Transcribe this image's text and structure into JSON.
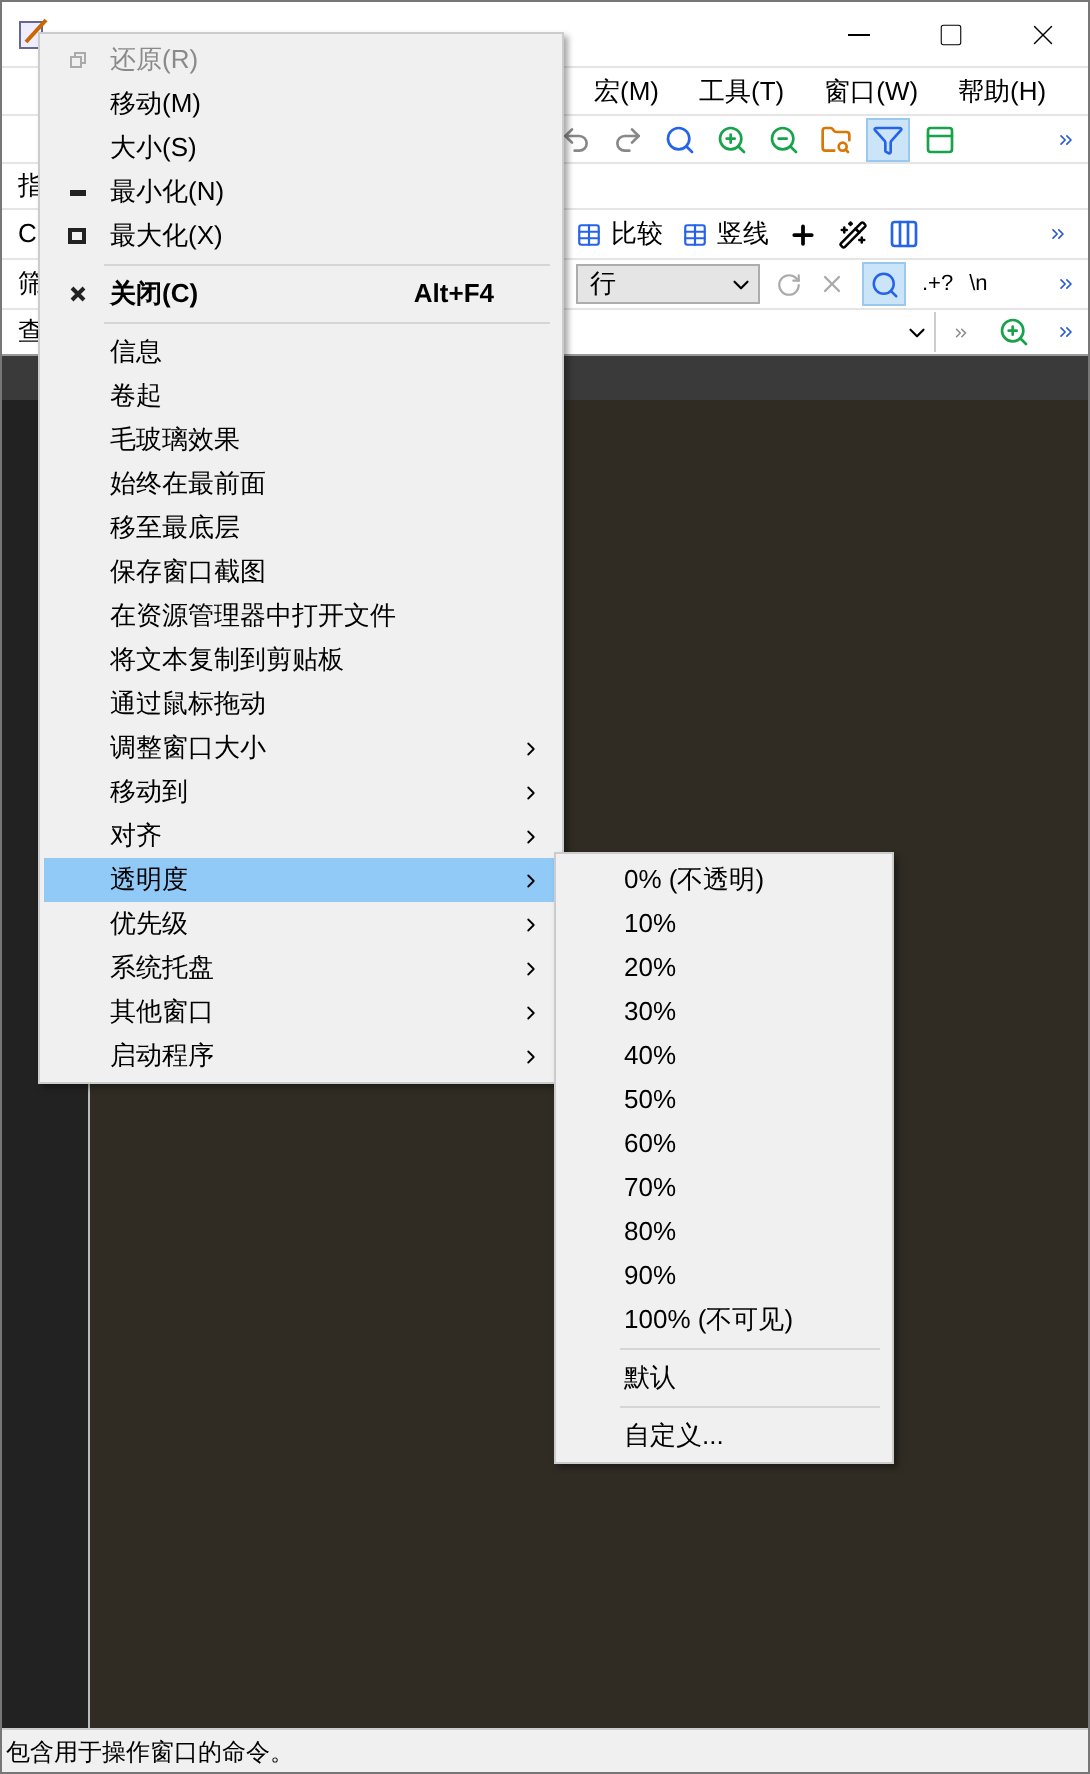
{
  "menubar": [
    {
      "label": "宏(M)"
    },
    {
      "label": "工具(T)"
    },
    {
      "label": "窗口(W)"
    },
    {
      "label": "帮助(H)"
    }
  ],
  "toolbar": [
    {
      "kind": "undo",
      "pressed": false
    },
    {
      "kind": "redo",
      "pressed": false
    },
    {
      "kind": "find",
      "pressed": false
    },
    {
      "kind": "find-next",
      "pressed": false
    },
    {
      "kind": "find-prev",
      "pressed": false
    },
    {
      "kind": "find-files",
      "pressed": false
    },
    {
      "kind": "filter",
      "pressed": true
    },
    {
      "kind": "panel",
      "pressed": false
    }
  ],
  "row_labels": [
    "指",
    "C",
    "筛",
    "查"
  ],
  "compare_bar": {
    "buttons": [
      {
        "label": "比较"
      },
      {
        "label": "竖线"
      }
    ]
  },
  "filter_bar": {
    "value": "行",
    "regex_label": ".+?",
    "newline_label": "\\n",
    "search_pressed": true
  },
  "system_menu": [
    {
      "kind": "restore",
      "label": "还原(R)",
      "disabled": true,
      "bold": false,
      "submenu": false,
      "selected": false
    },
    {
      "kind": "item",
      "label": "移动(M)",
      "disabled": false,
      "bold": false,
      "submenu": false,
      "selected": false
    },
    {
      "kind": "item",
      "label": "大小(S)",
      "disabled": false,
      "bold": false,
      "submenu": false,
      "selected": false
    },
    {
      "kind": "minimize",
      "label": "最小化(N)",
      "disabled": false,
      "bold": false,
      "submenu": false,
      "selected": false
    },
    {
      "kind": "maximize",
      "label": "最大化(X)",
      "disabled": false,
      "bold": false,
      "submenu": false,
      "selected": false
    },
    {
      "kind": "separator"
    },
    {
      "kind": "close",
      "label": "关闭(C)",
      "shortcut": "Alt+F4",
      "disabled": false,
      "bold": true,
      "submenu": false,
      "selected": false
    },
    {
      "kind": "separator"
    },
    {
      "kind": "item",
      "label": "信息",
      "disabled": false,
      "bold": false,
      "submenu": false,
      "selected": false
    },
    {
      "kind": "item",
      "label": "卷起",
      "disabled": false,
      "bold": false,
      "submenu": false,
      "selected": false
    },
    {
      "kind": "item",
      "label": "毛玻璃效果",
      "disabled": false,
      "bold": false,
      "submenu": false,
      "selected": false
    },
    {
      "kind": "item",
      "label": "始终在最前面",
      "disabled": false,
      "bold": false,
      "submenu": false,
      "selected": false
    },
    {
      "kind": "item",
      "label": "移至最底层",
      "disabled": false,
      "bold": false,
      "submenu": false,
      "selected": false
    },
    {
      "kind": "item",
      "label": "保存窗口截图",
      "disabled": false,
      "bold": false,
      "submenu": false,
      "selected": false
    },
    {
      "kind": "item",
      "label": "在资源管理器中打开文件",
      "disabled": false,
      "bold": false,
      "submenu": false,
      "selected": false
    },
    {
      "kind": "item",
      "label": "将文本复制到剪贴板",
      "disabled": false,
      "bold": false,
      "submenu": false,
      "selected": false
    },
    {
      "kind": "item",
      "label": "通过鼠标拖动",
      "disabled": false,
      "bold": false,
      "submenu": false,
      "selected": false
    },
    {
      "kind": "item",
      "label": "调整窗口大小",
      "disabled": false,
      "bold": false,
      "submenu": true,
      "selected": false
    },
    {
      "kind": "item",
      "label": "移动到",
      "disabled": false,
      "bold": false,
      "submenu": true,
      "selected": false
    },
    {
      "kind": "item",
      "label": "对齐",
      "disabled": false,
      "bold": false,
      "submenu": true,
      "selected": false
    },
    {
      "kind": "item",
      "label": "透明度",
      "disabled": false,
      "bold": false,
      "submenu": true,
      "selected": true
    },
    {
      "kind": "item",
      "label": "优先级",
      "disabled": false,
      "bold": false,
      "submenu": true,
      "selected": false
    },
    {
      "kind": "item",
      "label": "系统托盘",
      "disabled": false,
      "bold": false,
      "submenu": true,
      "selected": false
    },
    {
      "kind": "item",
      "label": "其他窗口",
      "disabled": false,
      "bold": false,
      "submenu": true,
      "selected": false
    },
    {
      "kind": "item",
      "label": "启动程序",
      "disabled": false,
      "bold": false,
      "submenu": true,
      "selected": false
    }
  ],
  "transparency_submenu": [
    {
      "kind": "item",
      "label": "0% (不透明)"
    },
    {
      "kind": "item",
      "label": "10%"
    },
    {
      "kind": "item",
      "label": "20%"
    },
    {
      "kind": "item",
      "label": "30%"
    },
    {
      "kind": "item",
      "label": "40%"
    },
    {
      "kind": "item",
      "label": "50%"
    },
    {
      "kind": "item",
      "label": "60%"
    },
    {
      "kind": "item",
      "label": "70%"
    },
    {
      "kind": "item",
      "label": "80%"
    },
    {
      "kind": "item",
      "label": "90%"
    },
    {
      "kind": "item",
      "label": "100% (不可见)"
    },
    {
      "kind": "separator"
    },
    {
      "kind": "item",
      "label": "默认"
    },
    {
      "kind": "separator"
    },
    {
      "kind": "item",
      "label": "自定义..."
    }
  ],
  "status_bar": {
    "text": "包含用于操作窗口的命令。"
  }
}
